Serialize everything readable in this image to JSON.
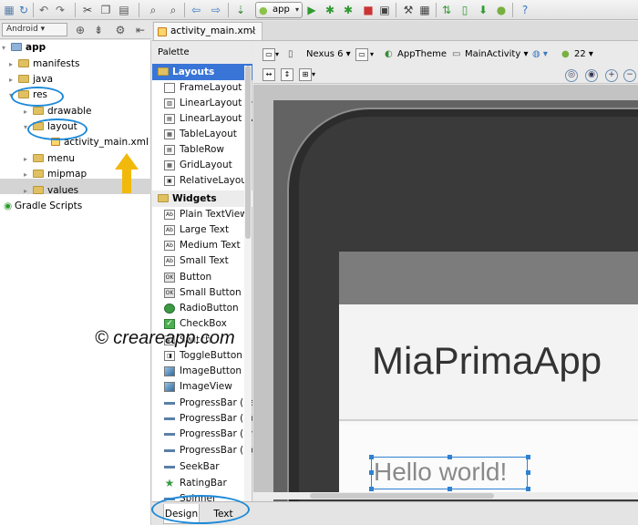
{
  "toolbar": {
    "run_config": "app",
    "icons": [
      "save-all-icon",
      "sync-icon",
      "undo-icon",
      "redo-icon",
      "cut-icon",
      "copy-icon",
      "paste-icon",
      "find-icon",
      "replace-icon",
      "back-icon",
      "forward-icon",
      "make-icon",
      "run-icon",
      "debug-icon",
      "attach-debugger-icon",
      "stop-icon",
      "device-icon",
      "settings-icon",
      "structure-icon",
      "sdk-manager-icon",
      "avd-manager-icon",
      "android-icon",
      "help-icon"
    ]
  },
  "project": {
    "view": "Android",
    "tree": [
      {
        "label": "app",
        "bold": true
      },
      {
        "label": "manifests"
      },
      {
        "label": "java"
      },
      {
        "label": "res"
      },
      {
        "label": "drawable"
      },
      {
        "label": "layout"
      },
      {
        "label": "activity_main.xml"
      },
      {
        "label": "menu"
      },
      {
        "label": "mipmap"
      },
      {
        "label": "values"
      },
      {
        "label": "Gradle Scripts"
      }
    ]
  },
  "editor": {
    "tab": "activity_main.xml"
  },
  "palette": {
    "title": "Palette",
    "categories": [
      {
        "label": "Layouts",
        "items": [
          "FrameLayout",
          "LinearLayout (Ho",
          "LinearLayout (Ve",
          "TableLayout",
          "TableRow",
          "GridLayout",
          "RelativeLayout"
        ]
      },
      {
        "label": "Widgets",
        "items": [
          "Plain TextView",
          "Large Text",
          "Medium Text",
          "Small Text",
          "Button",
          "Small Button",
          "RadioButton",
          "CheckBox",
          "Switch",
          "ToggleButton",
          "ImageButton",
          "ImageView",
          "ProgressBar (Larg",
          "ProgressBar (Nor",
          "ProgressBar (Sma",
          "ProgressBar (Hor",
          "SeekBar",
          "RatingBar",
          "Spinner"
        ]
      }
    ]
  },
  "design_toolbar": {
    "device": "Nexus 6",
    "theme": "AppTheme",
    "activity": "MainActivity",
    "api": "22"
  },
  "preview": {
    "app_title": "MiaPrimaApp",
    "text_view": "Hello world!"
  },
  "bottom_tabs": {
    "design": "Design",
    "text": "Text"
  },
  "watermark": "© creareapp.com",
  "colors": {
    "selection": "#3875d7",
    "annotation": "#1d8ad8",
    "arrow": "#f2b90d"
  }
}
